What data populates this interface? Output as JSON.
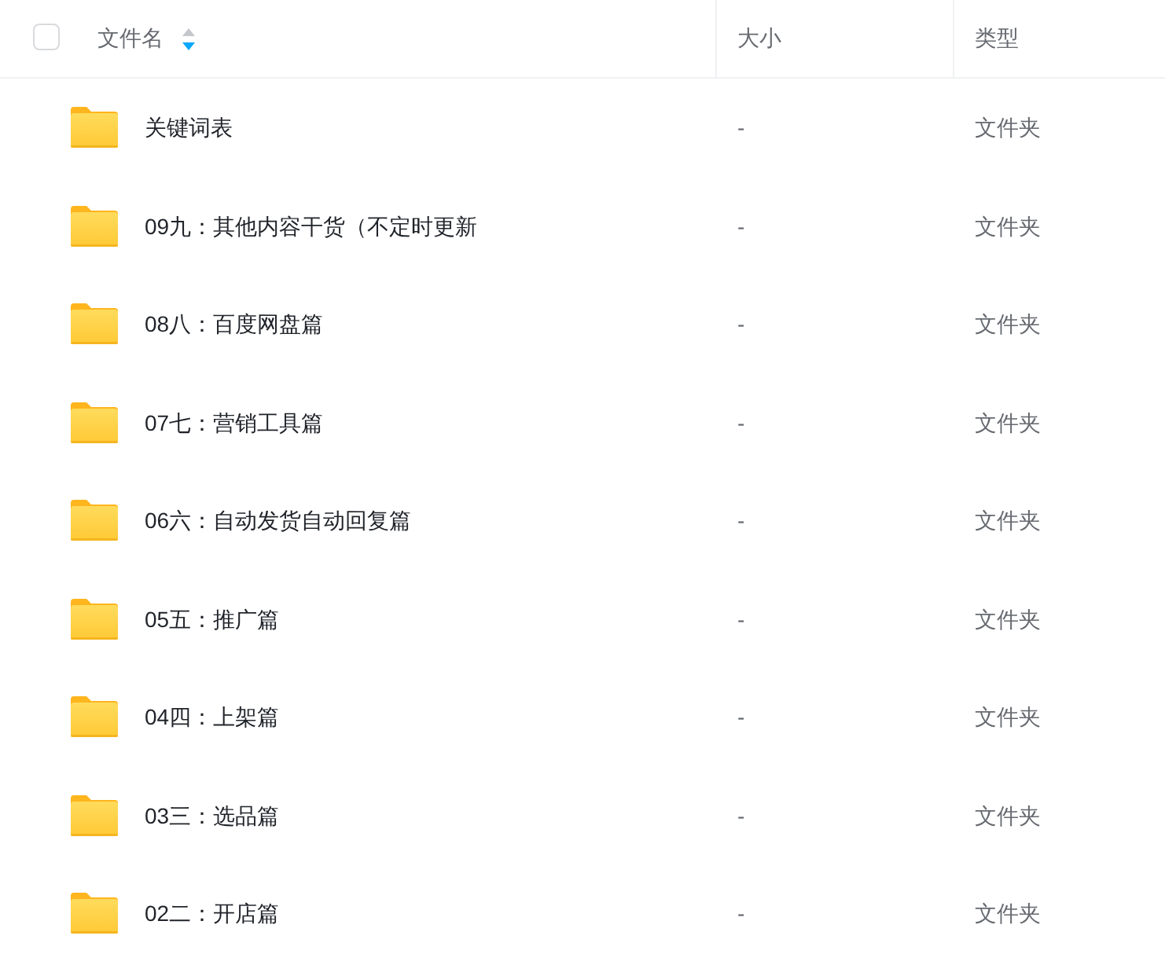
{
  "header": {
    "select_all": {
      "checked": false
    },
    "columns": [
      {
        "label": "文件名",
        "sort_up_active": false,
        "sort_down_active": true
      },
      {
        "label": "大小"
      },
      {
        "label": "类型"
      }
    ]
  },
  "rows": [
    {
      "kind": "folder",
      "name": "关键词表",
      "size": "-",
      "type": "文件夹"
    },
    {
      "kind": "folder",
      "name": "09九：其他内容干货（不定时更新",
      "size": "-",
      "type": "文件夹"
    },
    {
      "kind": "folder",
      "name": "08八：百度网盘篇",
      "size": "-",
      "type": "文件夹"
    },
    {
      "kind": "folder",
      "name": "07七：营销工具篇",
      "size": "-",
      "type": "文件夹"
    },
    {
      "kind": "folder",
      "name": "06六：自动发货自动回复篇",
      "size": "-",
      "type": "文件夹"
    },
    {
      "kind": "folder",
      "name": "05五：推广篇",
      "size": "-",
      "type": "文件夹"
    },
    {
      "kind": "folder",
      "name": "04四：上架篇",
      "size": "-",
      "type": "文件夹"
    },
    {
      "kind": "folder",
      "name": "03三：选品篇",
      "size": "-",
      "type": "文件夹"
    },
    {
      "kind": "folder",
      "name": "02二：开店篇",
      "size": "-",
      "type": "文件夹"
    }
  ]
}
